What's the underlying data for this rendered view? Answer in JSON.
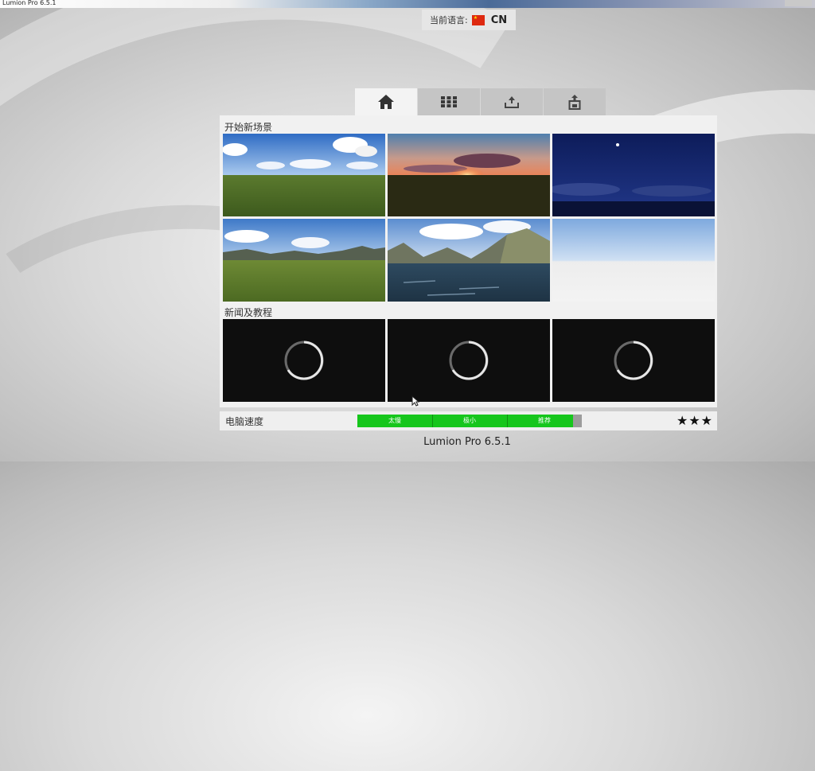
{
  "window": {
    "title": "Lumion Pro 6.5.1"
  },
  "language": {
    "label": "当前语言:",
    "code": "CN"
  },
  "tabs": [
    {
      "icon": "home-icon",
      "active": true
    },
    {
      "icon": "grid-icon",
      "active": false
    },
    {
      "icon": "upload-icon",
      "active": false
    },
    {
      "icon": "save-icon",
      "active": false
    }
  ],
  "start_scene": {
    "title": "开始新场景",
    "scenes": [
      {
        "name": "grassland-cloudy-sky"
      },
      {
        "name": "sunset"
      },
      {
        "name": "night-sky"
      },
      {
        "name": "hills-grassland"
      },
      {
        "name": "mountain-lake"
      },
      {
        "name": "blank-sky"
      }
    ]
  },
  "news": {
    "title": "新闻及教程",
    "items": [
      {
        "state": "loading"
      },
      {
        "state": "loading"
      },
      {
        "state": "loading"
      }
    ]
  },
  "speed": {
    "label": "电脑速度",
    "levels": [
      "太慢",
      "极小",
      "推荐"
    ],
    "fill_fraction": 0.96,
    "stars": "★★★"
  },
  "footer": {
    "version": "Lumion Pro 6.5.1"
  },
  "colors": {
    "speed_green": "#16c61c",
    "panel": "#f1f1f1",
    "flag_red": "#de2910"
  }
}
